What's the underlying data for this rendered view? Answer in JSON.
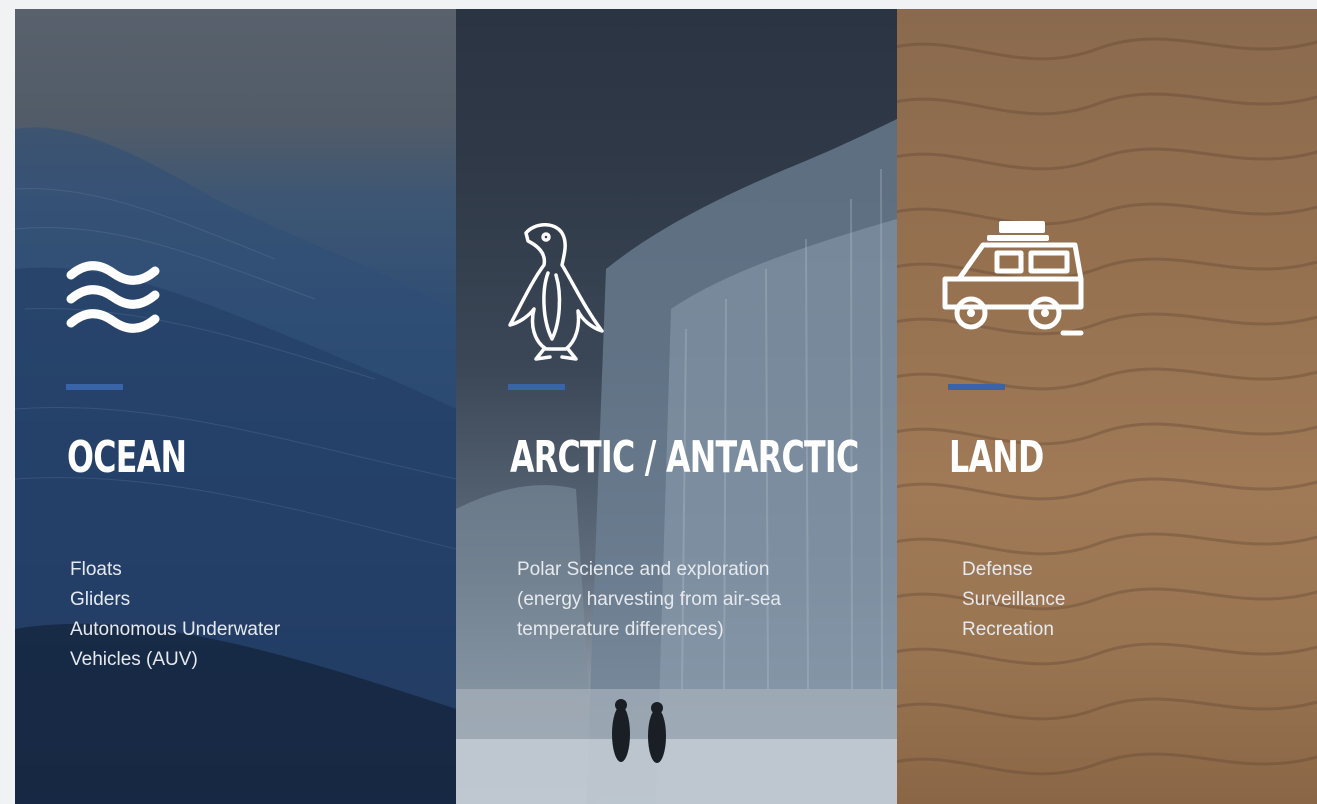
{
  "panels": {
    "ocean": {
      "icon": "waves-icon",
      "title": "OCEAN",
      "items": [
        "Floats",
        "Gliders",
        "Autonomous Underwater",
        "Vehicles (AUV)"
      ]
    },
    "arctic": {
      "icon": "penguin-icon",
      "title": "ARCTIC / ANTARCTIC",
      "lines": [
        "Polar Science and exploration",
        "(energy harvesting from air-sea",
        "temperature differences)"
      ]
    },
    "land": {
      "icon": "off-road-vehicle-icon",
      "title": "LAND",
      "items": [
        "Defense",
        "Surveillance",
        "Recreation"
      ]
    }
  },
  "colors": {
    "accent_bar": "#3a64a8",
    "heading": "#ffffff",
    "body_text": "#e6e9ee"
  }
}
